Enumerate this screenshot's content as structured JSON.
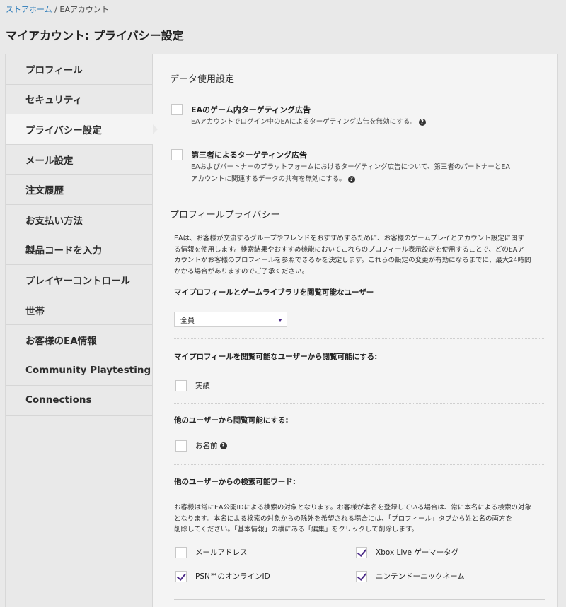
{
  "breadcrumb": {
    "home": "ストアホーム",
    "sep": "/",
    "current": "EAアカウント"
  },
  "page_title": "マイアカウント: プライバシー設定",
  "sidebar": {
    "items": [
      {
        "label": "プロフィール"
      },
      {
        "label": "セキュリティ"
      },
      {
        "label": "プライバシー設定",
        "active": true
      },
      {
        "label": "メール設定"
      },
      {
        "label": "注文履歴"
      },
      {
        "label": "お支払い方法"
      },
      {
        "label": "製品コードを入力"
      },
      {
        "label": "プレイヤーコントロール"
      },
      {
        "label": "世帯"
      },
      {
        "label": "お客様のEA情報"
      },
      {
        "label": "Community Playtesting"
      },
      {
        "label": "Connections"
      }
    ]
  },
  "data_usage": {
    "title": "データ使用設定",
    "opt1": {
      "label": "EAのゲーム内ターゲティング広告",
      "desc": "EAアカウントでログイン中のEAによるターゲティング広告を無効にする。",
      "checked": false
    },
    "opt2": {
      "label": "第三者によるターゲティング広告",
      "desc1": "EAおよびパートナーのプラットフォームにおけるターゲティング広告について、第三者のパートナーとEA",
      "desc2": "アカウントに関連するデータの共有を無効にする。",
      "checked": false
    }
  },
  "profile_privacy": {
    "title": "プロフィールプライバシー",
    "intro": [
      "EAは、お客様が交流するグループやフレンドをおすすめするために、お客様のゲームプレイとアカウント設定に関す",
      "る情報を使用します。検索結果やおすすめ機能においてこれらのプロフィール表示設定を使用することで、どのEAア",
      "カウントがお客様のプロフィールを参照できるかを決定します。これらの設定の変更が有効になるまでに、最大24時間",
      "かかる場合がありますのでご了承ください。"
    ],
    "q1": "マイプロフィールとゲームライブラリを閲覧可能なユーザー",
    "q1_select": "全員",
    "q2": "マイプロフィールを閲覧可能なユーザーから閲覧可能にする:",
    "q2_opt": {
      "label": "実績",
      "checked": false
    },
    "q3": "他のユーザーから閲覧可能にする:",
    "q3_opt": {
      "label": "お名前",
      "checked": false
    },
    "q4": "他のユーザーからの検索可能ワード:",
    "q4_desc": [
      "お客様は常にEA公開IDによる検索の対象となります。お客様が本名を登録している場合は、常に本名による検索の対象",
      "となります。本名による検索の対象からの除外を希望される場合には、「プロフィール」タブから姓と名の両方を",
      "削除してください。「基本情報」の横にある「編集」をクリックして削除します。"
    ],
    "search_opts": {
      "email": {
        "label": "メールアドレス",
        "checked": false
      },
      "xbox": {
        "label": "Xbox Live ゲーマータグ",
        "checked": true
      },
      "psn": {
        "label": "PSN℠のオンラインID",
        "checked": true
      },
      "nintendo": {
        "label": "ニンテンドーニックネーム",
        "checked": true
      }
    }
  },
  "help_glyph": "?",
  "colors": {
    "link": "#2a7ab8",
    "check": "#4b2a87"
  }
}
